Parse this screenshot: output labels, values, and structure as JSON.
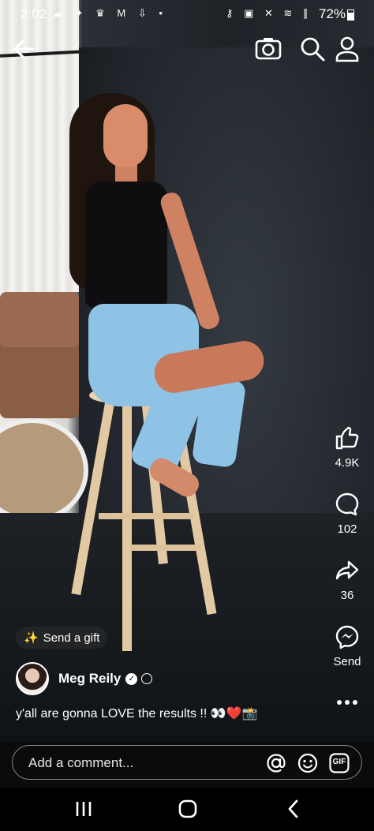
{
  "status_bar": {
    "time": "2:02",
    "left_icons": "☁ ✦ ♛ M ⇩ •",
    "right_icons": "⚷ ▣ ✕ ≋ ∥",
    "battery": "72%"
  },
  "top_bar": {
    "back_icon": "arrow-left-icon",
    "camera_icon": "camera-icon",
    "search_icon": "search-icon",
    "profile_icon": "profile-icon"
  },
  "rail": {
    "like": {
      "icon": "thumbs-up-icon",
      "count": "4.9K"
    },
    "comment": {
      "icon": "comment-icon",
      "count": "102"
    },
    "share": {
      "icon": "share-icon",
      "count": "36"
    },
    "send": {
      "icon": "messenger-icon",
      "label": "Send"
    },
    "more": {
      "icon": "more-icon"
    }
  },
  "gift": {
    "label": "Send a gift"
  },
  "author": {
    "name": "Meg Reily"
  },
  "caption": {
    "text": "y'all are gonna LOVE the results !! 👀❤️📸"
  },
  "comment": {
    "placeholder": "Add a comment...",
    "mention_icon": "at-icon",
    "emoji_icon": "emoji-icon",
    "gif_label": "GIF"
  },
  "navbar": {
    "recents": "recents-icon",
    "home": "home-icon",
    "back": "back-icon"
  }
}
